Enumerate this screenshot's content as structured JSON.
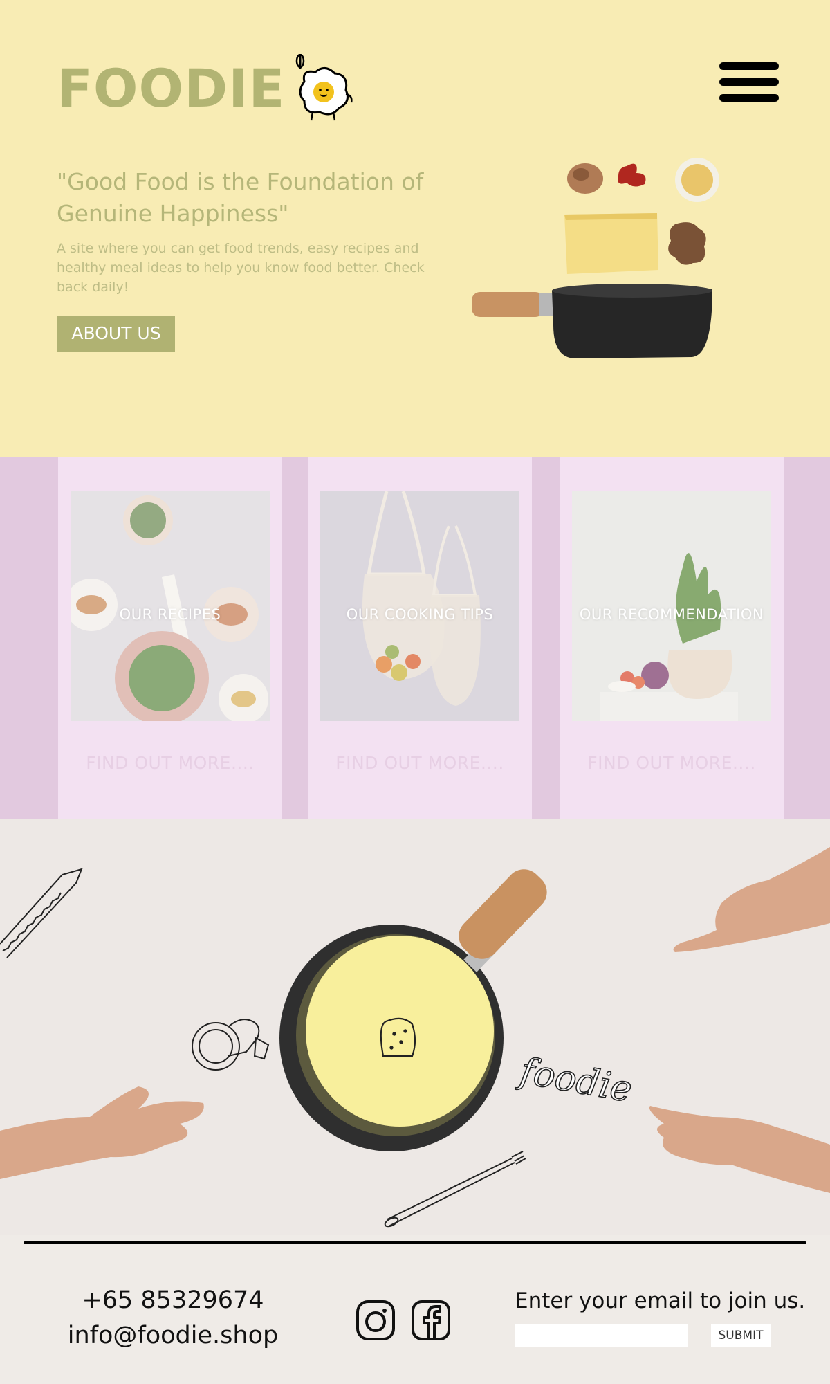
{
  "brand": {
    "name": "FOODIE"
  },
  "hero": {
    "quote": "\"Good Food is the Foundation of Genuine Happiness\"",
    "description": "A site where you can get food trends, easy recipes and healthy meal ideas to help you know food better. Check back daily!",
    "about_label": "ABOUT US"
  },
  "cards": [
    {
      "label": "OUR RECIPES",
      "link": "FIND OUT MORE...."
    },
    {
      "label": "OUR COOKING TIPS",
      "link": "FIND OUT MORE...."
    },
    {
      "label": "OUR  RECOMMENDATION",
      "link": "FIND OUT MORE...."
    }
  ],
  "feature": {
    "script_text": "foodie"
  },
  "footer": {
    "phone": "+65 85329674",
    "email": "info@foodie.shop",
    "signup_label": "Enter your email to join us.",
    "email_placeholder": "",
    "submit_label": "SUBMIT"
  },
  "icons": {
    "menu": "hamburger-menu-icon",
    "instagram": "instagram-icon",
    "facebook": "facebook-icon"
  },
  "colors": {
    "hero_bg": "#f8ecb4",
    "brand_olive": "#b2b473",
    "cards_bg": "#e2c9df",
    "card_bg": "#f3e1f2",
    "feature_bg": "#ede8e5"
  }
}
